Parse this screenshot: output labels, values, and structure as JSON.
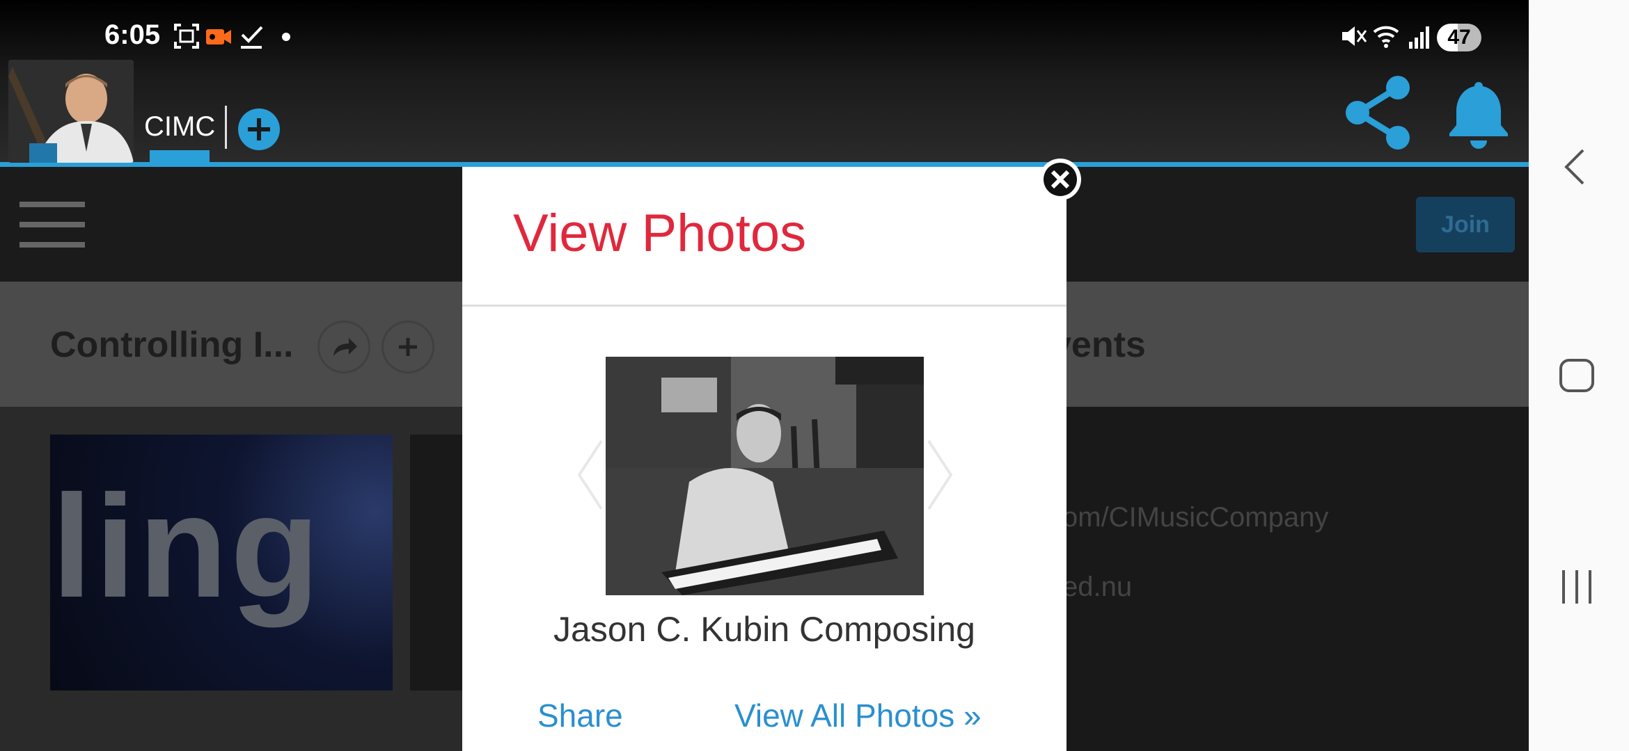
{
  "status_bar": {
    "time": "6:05",
    "battery": "47",
    "icons": [
      "screenshot-icon",
      "video-record-icon",
      "checkmark-icon",
      "dot-icon",
      "mute-icon",
      "wifi-icon",
      "signal-icon",
      "battery-icon"
    ]
  },
  "header": {
    "app_name": "CIMC",
    "add_icon": "plus-icon",
    "share_icon": "share-icon",
    "bell_icon": "bell-icon"
  },
  "navbar": {
    "menu_icon": "hamburger-icon",
    "join_label": "Join"
  },
  "page": {
    "title": "Controlling I...",
    "events_title": "vents",
    "info_lines": [
      "om/CIMusicCompany",
      "ed.nu"
    ],
    "thumb_text": "ling"
  },
  "modal": {
    "title": "View Photos",
    "caption": "Jason C. Kubin Composing",
    "share_label": "Share",
    "view_all_label": "View All Photos »"
  },
  "colors": {
    "accent": "#2a9fd8",
    "modal_title": "#e0283c",
    "link": "#2a8fd0"
  }
}
